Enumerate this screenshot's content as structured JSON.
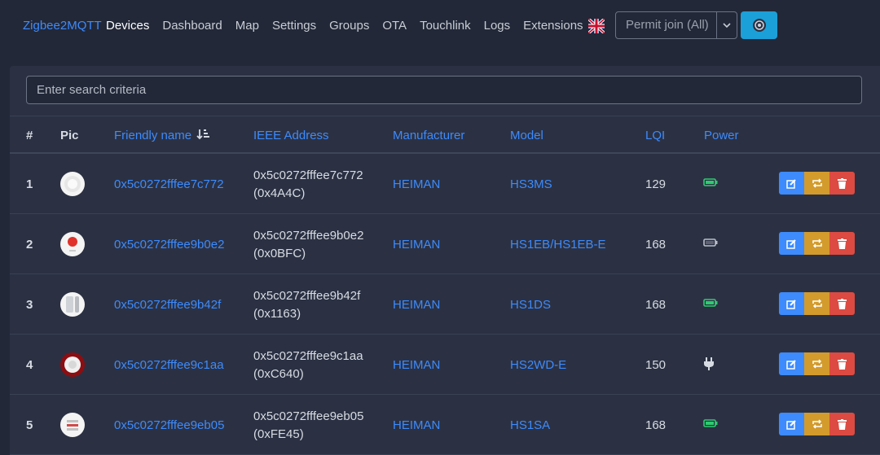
{
  "navbar": {
    "brand": "Zigbee2MQTT",
    "links": [
      "Devices",
      "Dashboard",
      "Map",
      "Settings",
      "Groups",
      "OTA",
      "Touchlink",
      "Logs",
      "Extensions"
    ],
    "active": "Devices",
    "language_icon": "uk-flag-icon",
    "permit_join_label": "Permit join (All)",
    "permit_join_caret_icon": "chevron-down-icon",
    "zigbee_button_icon": "zigbee-icon"
  },
  "search": {
    "placeholder": "Enter search criteria",
    "value": ""
  },
  "table": {
    "headers": {
      "index": "#",
      "pic": "Pic",
      "friendly_name": "Friendly name",
      "friendly_name_sort_icon": "sort-amount-down-icon",
      "ieee": "IEEE Address",
      "manufacturer": "Manufacturer",
      "model": "Model",
      "lqi": "LQI",
      "power": "Power"
    },
    "rows": [
      {
        "index": "1",
        "friendly_name": "0x5c0272fffee7c772",
        "ieee": "0x5c0272fffee7c772",
        "nwk": "(0x4A4C)",
        "manufacturer": "HEIMAN",
        "model": "HS3MS",
        "lqi": "129",
        "power": "battery",
        "power_icon": "battery-full-icon",
        "power_color": "#2ecc71",
        "pic_icon": "motion-sensor-icon"
      },
      {
        "index": "2",
        "friendly_name": "0x5c0272fffee9b0e2",
        "ieee": "0x5c0272fffee9b0e2",
        "nwk": "(0x0BFC)",
        "manufacturer": "HEIMAN",
        "model": "HS1EB/HS1EB-E",
        "lqi": "168",
        "power": "battery",
        "power_icon": "battery-empty-icon",
        "power_color": "#b9bec8",
        "pic_icon": "emergency-button-icon"
      },
      {
        "index": "3",
        "friendly_name": "0x5c0272fffee9b42f",
        "ieee": "0x5c0272fffee9b42f",
        "nwk": "(0x1163)",
        "manufacturer": "HEIMAN",
        "model": "HS1DS",
        "lqi": "168",
        "power": "battery",
        "power_icon": "battery-full-icon",
        "power_color": "#2ecc71",
        "pic_icon": "door-sensor-icon"
      },
      {
        "index": "4",
        "friendly_name": "0x5c0272fffee9c1aa",
        "ieee": "0x5c0272fffee9c1aa",
        "nwk": "(0xC640)",
        "manufacturer": "HEIMAN",
        "model": "HS2WD-E",
        "lqi": "150",
        "power": "mains",
        "power_icon": "plug-icon",
        "power_color": "#d7dbe3",
        "pic_icon": "siren-icon"
      },
      {
        "index": "5",
        "friendly_name": "0x5c0272fffee9eb05",
        "ieee": "0x5c0272fffee9eb05",
        "nwk": "(0xFE45)",
        "manufacturer": "HEIMAN",
        "model": "HS1SA",
        "lqi": "168",
        "power": "battery",
        "power_icon": "battery-full-icon",
        "power_color": "#2ecc71",
        "pic_icon": "smoke-detector-icon"
      }
    ],
    "row_actions": [
      "edit-icon",
      "rename-icon",
      "trash-icon"
    ]
  }
}
